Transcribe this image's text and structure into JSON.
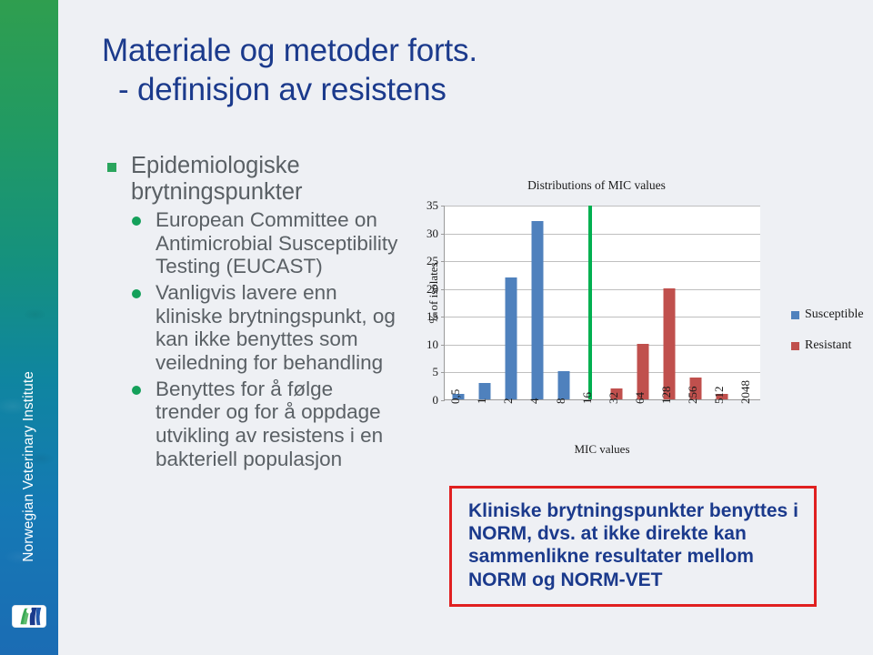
{
  "sidebar": {
    "organization": "Norwegian Veterinary Institute",
    "logo_icon": "veterinary-institute-wave-logo",
    "gradient_top": "#2f9e4f",
    "gradient_bottom": "#1b6cb4"
  },
  "title": {
    "line1": "Materiale og metoder forts.",
    "line2": "- definisjon av resistens",
    "color": "#1b3a8c"
  },
  "bullets": [
    {
      "marker": "green-square-bullet",
      "text": "Epidemiologiske brytningspunkter",
      "children": [
        {
          "marker": "green-dot-bullet",
          "text": "European Committee on Antimicrobial Susceptibility Testing (EUCAST)"
        },
        {
          "marker": "green-dot-bullet",
          "text": "Vanligvis lavere enn kliniske brytningspunkt, og kan ikke benyttes som veiledning for behandling"
        },
        {
          "marker": "green-dot-bullet",
          "text": "Benyttes for å følge trender og for å oppdage utvikling av resistens i en bakteriell populasjon"
        }
      ]
    }
  ],
  "caption": {
    "text": "Kliniske brytningspunkter benyttes i NORM, dvs. at ikke direkte kan sammenlikne resultater mellom NORM og NORM-VET",
    "border_color": "#e02020",
    "text_color": "#1b3a8c"
  },
  "chart_data": {
    "type": "bar",
    "title": "Distributions of MIC values",
    "xlabel": "MIC values",
    "ylabel": "% of isolates",
    "categories": [
      "0,5",
      "1",
      "2",
      "4",
      "8",
      "16",
      "32",
      "64",
      "128",
      "256",
      "512",
      "2048"
    ],
    "series": [
      {
        "name": "Susceptible",
        "color": "#4f81bd",
        "values": [
          1,
          3,
          22,
          32,
          5,
          0,
          0,
          0,
          0,
          0,
          0,
          0
        ]
      },
      {
        "name": "Resistant",
        "color": "#c0504d",
        "values": [
          0,
          0,
          0,
          0,
          0,
          0,
          2,
          10,
          20,
          4,
          1,
          0
        ]
      }
    ],
    "ylim": [
      0,
      35
    ],
    "yticks": [
      0,
      5,
      10,
      15,
      20,
      25,
      30,
      35
    ],
    "grid": true,
    "legend_position": "right",
    "annotations": [
      {
        "name": "breakpoint-line",
        "type": "vline",
        "at_category": "16",
        "color": "#00b050"
      }
    ]
  }
}
